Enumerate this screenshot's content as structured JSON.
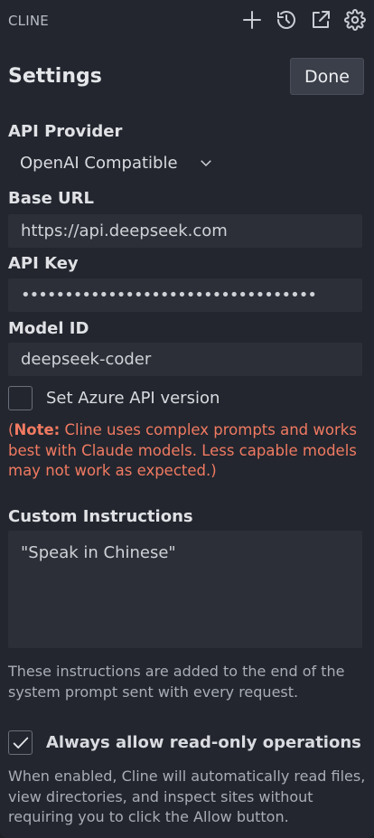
{
  "app": {
    "title": "CLINE"
  },
  "toolbar": {
    "icons": [
      "plus-icon",
      "history-icon",
      "external-link-icon",
      "gear-icon"
    ]
  },
  "settings": {
    "title": "Settings",
    "done_label": "Done",
    "api_provider": {
      "label": "API Provider",
      "value": "OpenAI Compatible"
    },
    "base_url": {
      "label": "Base URL",
      "value": "https://api.deepseek.com"
    },
    "api_key": {
      "label": "API Key",
      "value": "••••••••••••••••••••••••••••••••••"
    },
    "model_id": {
      "label": "Model ID",
      "value": "deepseek-coder"
    },
    "azure": {
      "label": "Set Azure API version",
      "checked": false
    },
    "note": {
      "prefix": "(",
      "bold": "Note:",
      "text": " Cline uses complex prompts and works best with Claude models. Less capable models may not work as expected.)"
    },
    "custom_instructions": {
      "label": "Custom Instructions",
      "value": "\"Speak in Chinese\"",
      "help": "These instructions are added to the end of the system prompt sent with every request."
    },
    "read_only": {
      "label": "Always allow read-only operations",
      "checked": true,
      "help": "When enabled, Cline will automatically read files, view directories, and inspect sites without requiring you to click the Allow button."
    }
  },
  "colors": {
    "accent_note": "#f07a62",
    "background": "#23262e",
    "field": "#2c2f37"
  }
}
